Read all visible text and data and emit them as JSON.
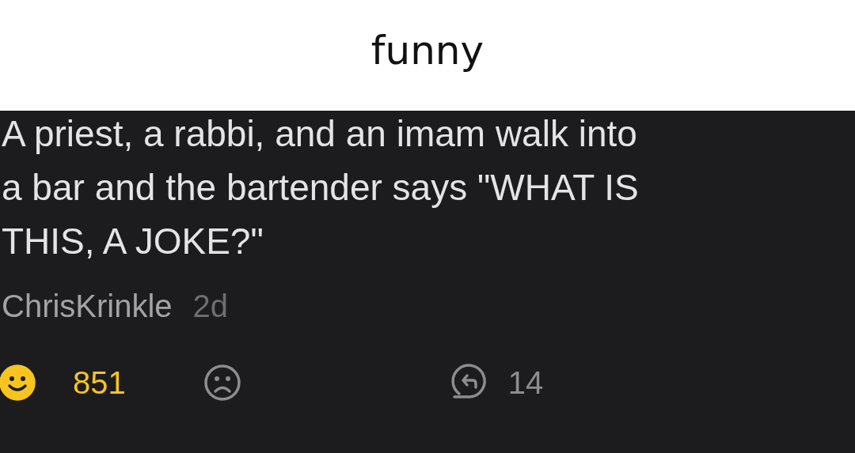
{
  "caption": "funny",
  "post": {
    "lines": [
      "A priest, a rabbi, and an imam walk into",
      "a bar and the bartender says \"WHAT IS",
      "THIS, A JOKE?\""
    ],
    "author": "ChrisKrinkle",
    "age": "2d",
    "upvote": {
      "selected": true,
      "count": "851"
    },
    "downvote": {
      "selected": false
    },
    "repost": {
      "count": "14"
    }
  }
}
